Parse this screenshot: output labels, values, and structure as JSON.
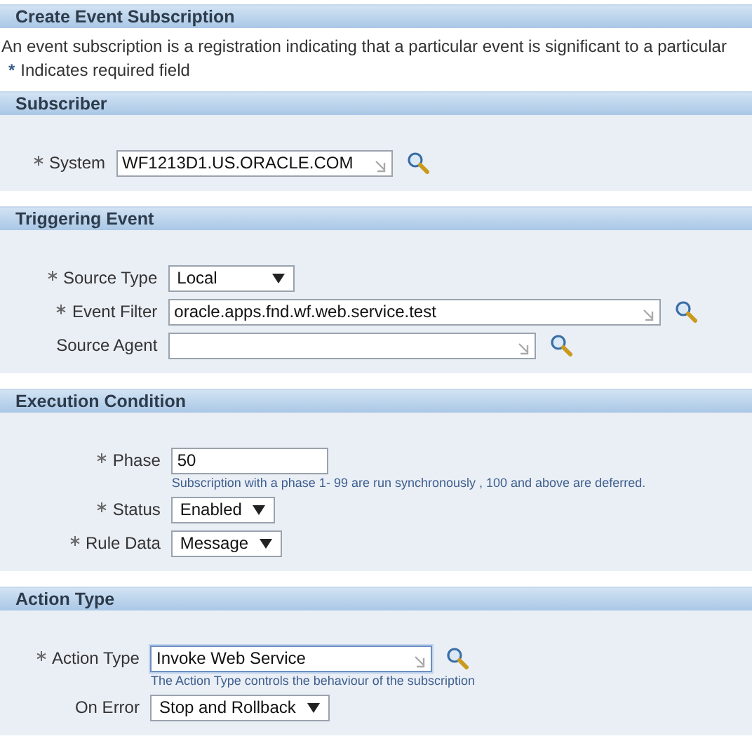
{
  "page_title": "Create Event Subscription",
  "description": "An event subscription is a registration indicating that a particular event is significant to a particular",
  "required_note": {
    "mark": "*",
    "text": "Indicates required field"
  },
  "sections": [
    {
      "title": "Subscriber",
      "fields": [
        {
          "kind": "lov",
          "label": "System",
          "required": true,
          "value": "WF1213D1.US.ORACLE.COM",
          "focused": false
        }
      ]
    },
    {
      "title": "Triggering Event",
      "fields": [
        {
          "kind": "select",
          "label": "Source Type",
          "required": true,
          "value": "Local"
        },
        {
          "kind": "lov",
          "label": "Event Filter",
          "required": true,
          "value": "oracle.apps.fnd.wf.web.service.test",
          "focused": false
        },
        {
          "kind": "lov",
          "label": "Source Agent",
          "required": false,
          "focused": false
        }
      ]
    },
    {
      "title": "Execution Condition",
      "fields": [
        {
          "kind": "text",
          "label": "Phase",
          "required": true,
          "value": "50",
          "hint": "Subscription with a phase 1- 99 are run synchronously , 100 and above are deferred."
        },
        {
          "kind": "select",
          "label": "Status",
          "required": true,
          "value": "Enabled"
        },
        {
          "kind": "select",
          "label": "Rule Data",
          "required": true,
          "value": "Message"
        }
      ]
    },
    {
      "title": "Action Type",
      "fields": [
        {
          "kind": "lov",
          "label": "Action Type",
          "required": true,
          "value": "Invoke Web Service",
          "focused": true,
          "hint": "The Action Type controls the behaviour of the subscription"
        },
        {
          "kind": "select",
          "label": "On Error",
          "required": false,
          "value": "Stop and Rollback"
        }
      ]
    }
  ]
}
